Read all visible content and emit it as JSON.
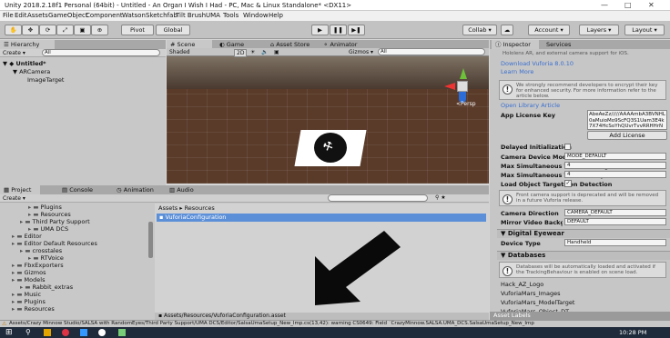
{
  "window": {
    "title": "Unity 2018.2.18f1 Personal (64bit) - Untitled - An Organ I Wish I Had - PC, Mac & Linux Standalone* <DX11>",
    "controls": [
      "—",
      "□",
      "✕"
    ]
  },
  "menu": [
    "File",
    "Edit",
    "Assets",
    "GameObject",
    "Component",
    "Watson",
    "Sketchfab",
    "Tilt Brush",
    "UMA",
    "Tools",
    "Window",
    "Help"
  ],
  "toolbar": {
    "pivot": "Pivot",
    "global": "Global",
    "collab": "Collab ▾",
    "account": "Account ▾",
    "layers": "Layers ▾",
    "layout": "Layout ▾"
  },
  "hierarchy": {
    "tab": "Hierarchy",
    "create": "Create ▾",
    "search_placeholder": "All",
    "scene": "Untitled*",
    "items": [
      "ARCamera",
      "ImageTarget"
    ]
  },
  "scene_view": {
    "tabs": [
      "Scene",
      "Game",
      "Asset Store",
      "Animator"
    ],
    "shading": "Shaded",
    "mode2d": "2D",
    "gizmos": "Gizmos ▾",
    "search": "All",
    "persp": "<Persp"
  },
  "project": {
    "tabs": [
      "Project",
      "Console",
      "Animation",
      "Audio Mixer"
    ],
    "create": "Create ▾",
    "breadcrumb": [
      "Assets",
      "Resources"
    ],
    "selected_file": "VuforiaConfiguration",
    "path": "Assets/Resources/VuforiaConfiguration.asset",
    "tree": [
      {
        "label": "Plugins",
        "indent": 3
      },
      {
        "label": "Resources",
        "indent": 3
      },
      {
        "label": "Third Party Support",
        "indent": 2
      },
      {
        "label": "UMA DCS",
        "indent": 3
      },
      {
        "label": "Editor",
        "indent": 1
      },
      {
        "label": "Editor Default Resources",
        "indent": 1
      },
      {
        "label": "crosstales",
        "indent": 2
      },
      {
        "label": "RTVoice",
        "indent": 3
      },
      {
        "label": "FbxExporters",
        "indent": 1
      },
      {
        "label": "Gizmos",
        "indent": 1
      },
      {
        "label": "Models",
        "indent": 1
      },
      {
        "label": "Rabbit_extras",
        "indent": 2
      },
      {
        "label": "Music",
        "indent": 1
      },
      {
        "label": "Plugins",
        "indent": 1
      },
      {
        "label": "Resources",
        "indent": 1
      }
    ]
  },
  "inspector": {
    "tabs": [
      "Inspector",
      "Services"
    ],
    "top_note": "Hololens AR, and external camera support for iOS.",
    "download_link": "Download Vuforia 8.0.10",
    "learn_more": "Learn More",
    "license_info": "We strongly recommend developers to encrypt their key for enhanced security. For more information refer to the article below.",
    "open_library": "Open Library Article",
    "app_license_label": "App License Key",
    "app_license_key": "AbeAeZz/////AAAAmbA3BVNHL0aMuioMo9ScFQ3S1Uam3E4k7X74HcSoYhQUvrTvvRRHHrNmHKUr",
    "add_license": "Add License",
    "delayed_init": "Delayed Initialization",
    "fields": [
      {
        "label": "Camera Device Mode",
        "value": "MODE_DEFAULT"
      },
      {
        "label": "Max Simultaneous Tracked Images",
        "value": "4"
      },
      {
        "label": "Max Simultaneous Tracked Objects",
        "value": "4"
      },
      {
        "label": "Load Object Targets on Detection",
        "value": "✓"
      }
    ],
    "front_cam_info": "Front camera support is deprecated and will be removed in a future Vuforia release.",
    "camera_direction": {
      "label": "Camera Direction",
      "value": "CAMERA_DEFAULT"
    },
    "mirror_video": {
      "label": "Mirror Video Background",
      "value": "DEFAULT"
    },
    "digital_eyewear": "Digital Eyewear",
    "device_type": {
      "label": "Device Type",
      "value": "Handheld"
    },
    "databases": "Databases",
    "db_info": "Databases will be automatically loaded and activated if the TrackingBehaviour is enabled on scene load.",
    "db_items": [
      "Hack_AZ_Logo",
      "VuforiaMars_Images",
      "VuforiaMars_ModelTarget",
      "VuforiaMars_Object_DT"
    ],
    "asset_labels": "Asset Labels"
  },
  "status": {
    "warning": "Assets/Crazy Minnow Studio/SALSA with RandomEyes/Third Party Support/UMA DCS/Editor/SalsaUmaSetup_New_Imp.cs(13,42): warning CS0649: Field `CrazyMinnow.SALSA.UMA_DCS.SalsaUmaSetup_New_Imp"
  },
  "taskbar": {
    "time": "10:28 PM"
  }
}
